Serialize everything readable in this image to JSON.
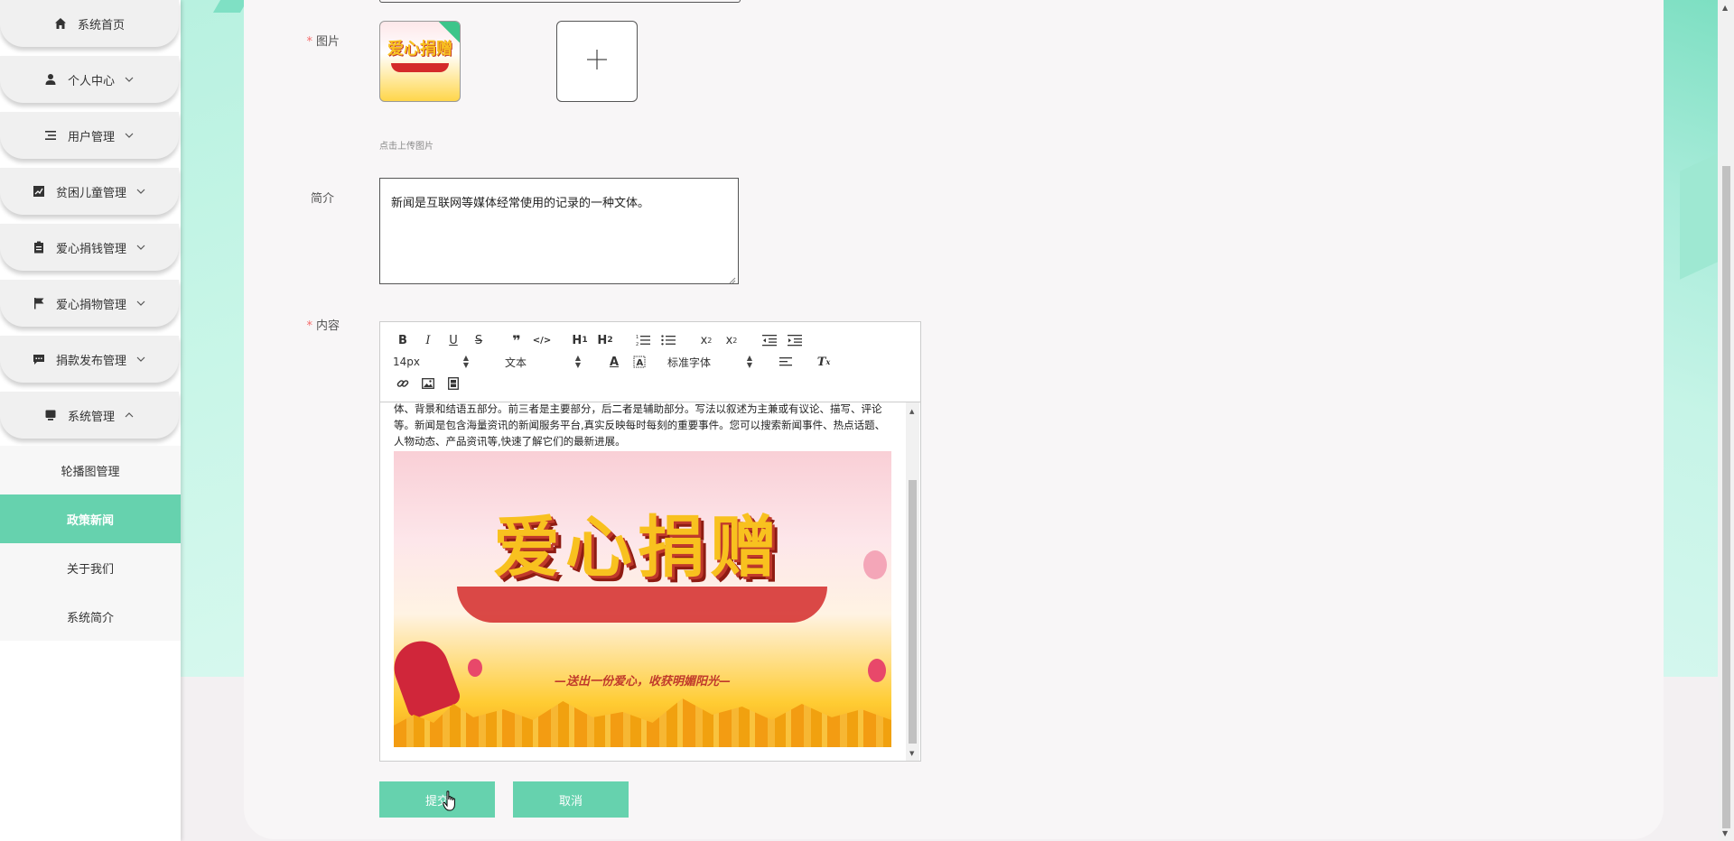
{
  "sidebar": {
    "items": [
      {
        "label": "系统首页",
        "icon": "home-icon",
        "has_arrow": false
      },
      {
        "label": "个人中心",
        "icon": "user-icon",
        "has_arrow": true,
        "arrow": "down"
      },
      {
        "label": "用户管理",
        "icon": "list-icon",
        "has_arrow": true,
        "arrow": "down"
      },
      {
        "label": "贫困儿童管理",
        "icon": "chart-icon",
        "has_arrow": true,
        "arrow": "down"
      },
      {
        "label": "爱心捐钱管理",
        "icon": "clipboard-icon",
        "has_arrow": true,
        "arrow": "down"
      },
      {
        "label": "爱心捐物管理",
        "icon": "flag-icon",
        "has_arrow": true,
        "arrow": "down"
      },
      {
        "label": "捐款发布管理",
        "icon": "message-icon",
        "has_arrow": true,
        "arrow": "down"
      },
      {
        "label": "系统管理",
        "icon": "monitor-icon",
        "has_arrow": true,
        "arrow": "up"
      }
    ],
    "submenu": [
      {
        "label": "轮播图管理",
        "active": false
      },
      {
        "label": "政策新闻",
        "active": true
      },
      {
        "label": "关于我们",
        "active": false
      },
      {
        "label": "系统简介",
        "active": false
      }
    ]
  },
  "form": {
    "image_label": "图片",
    "upload_tip": "点击上传图片",
    "intro_label": "简介",
    "intro_value": "新闻是互联网等媒体经常使用的记录的一种文体。",
    "content_label": "内容"
  },
  "editor": {
    "toolbar": {
      "font_size": "14px",
      "block_type": "文本",
      "font_family": "标准字体"
    },
    "content_text": "体、背景和结语五部分。前三者是主要部分，后二者是辅助部分。写法以叙述为主兼或有议论、描写、评论等。新闻是包含海量资讯的新闻服务平台,真实反映每时每刻的重要事件。您可以搜索新闻事件、热点话题、人物动态、产品资讯等,快速了解它们的最新进展。",
    "image": {
      "banner_text": "爱心捐赠",
      "slogan": "—送出一份爱心，收获明媚阳光—"
    }
  },
  "buttons": {
    "submit": "提交",
    "cancel": "取消"
  },
  "colors": {
    "accent": "#66d2ae",
    "required": "#f56c6c"
  }
}
